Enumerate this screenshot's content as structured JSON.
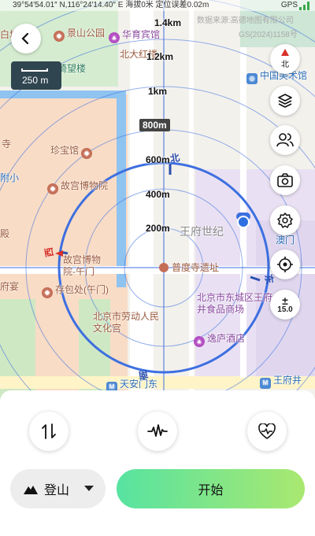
{
  "status_bar": {
    "coords": "39°54′54.01″ N,116°24′14.40″ E 海拔0米 定位误差0.02m",
    "gps": "GPS"
  },
  "map": {
    "attribution": "数据来源:高德地图有限公司",
    "gs_number": "GS(2024)1158号",
    "scale_label": "250 m",
    "zoom_level": "15.0",
    "compass_label": "北",
    "distance_labels": [
      "1.4km",
      "1.2km",
      "1km",
      "800m",
      "600m",
      "400m",
      "200m"
    ],
    "compass_letters": {
      "north": "北",
      "south": "南",
      "east": "东",
      "west": "西"
    },
    "pois": {
      "jingshan_park": "景山公园",
      "huayu_hotel": "华育宾馆",
      "beida_hospital": "北大红楼",
      "qiwanglou": "绮望楼",
      "art_museum": "中国美术馆",
      "treasure_hall": "珍宝馆",
      "palace_museum": "故宫博物院",
      "wangfu_century": "王府世纪",
      "palace_museum_meridian": "故宫博物院-午门",
      "pudu_temple": "普度寺遗址",
      "cunbao_zhai": "存包处(午门)",
      "labor_palace": "北京市劳动人民文化宫",
      "wangfujing_food": "北京市东城区王府井食品商场",
      "yifu_hotel": "逸庐酒店",
      "tiananmen": "天安门东",
      "wangfujing": "王府井",
      "aomen": "澳门",
      "temple_left": "寺",
      "fuxiao": "附小",
      "palace_left": "殿",
      "banquet": "府宴",
      "bai_left": "白塔"
    }
  },
  "panel": {
    "mode_label": "登山",
    "start_label": "开始",
    "buttons": [
      "swap-icon",
      "waveform-icon",
      "heart-pulse-icon"
    ]
  },
  "colors": {
    "ring_blue": "#3d6fe0",
    "start_gradient_start": "#57e3a1",
    "start_gradient_end": "#a9e870",
    "poi_brown": "#9b5a3e",
    "poi_purple": "#8a4a9f"
  }
}
